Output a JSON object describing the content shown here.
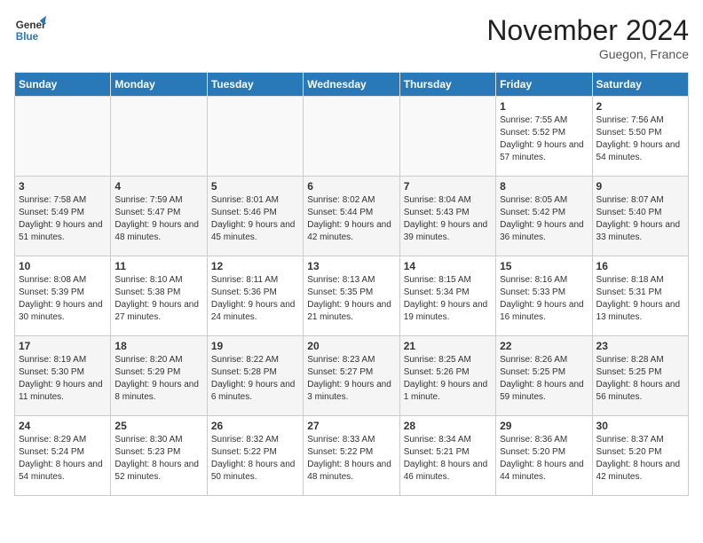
{
  "logo": {
    "line1": "General",
    "line2": "Blue"
  },
  "title": "November 2024",
  "location": "Guegon, France",
  "headers": [
    "Sunday",
    "Monday",
    "Tuesday",
    "Wednesday",
    "Thursday",
    "Friday",
    "Saturday"
  ],
  "weeks": [
    [
      {
        "day": "",
        "info": ""
      },
      {
        "day": "",
        "info": ""
      },
      {
        "day": "",
        "info": ""
      },
      {
        "day": "",
        "info": ""
      },
      {
        "day": "",
        "info": ""
      },
      {
        "day": "1",
        "info": "Sunrise: 7:55 AM\nSunset: 5:52 PM\nDaylight: 9 hours and 57 minutes."
      },
      {
        "day": "2",
        "info": "Sunrise: 7:56 AM\nSunset: 5:50 PM\nDaylight: 9 hours and 54 minutes."
      }
    ],
    [
      {
        "day": "3",
        "info": "Sunrise: 7:58 AM\nSunset: 5:49 PM\nDaylight: 9 hours and 51 minutes."
      },
      {
        "day": "4",
        "info": "Sunrise: 7:59 AM\nSunset: 5:47 PM\nDaylight: 9 hours and 48 minutes."
      },
      {
        "day": "5",
        "info": "Sunrise: 8:01 AM\nSunset: 5:46 PM\nDaylight: 9 hours and 45 minutes."
      },
      {
        "day": "6",
        "info": "Sunrise: 8:02 AM\nSunset: 5:44 PM\nDaylight: 9 hours and 42 minutes."
      },
      {
        "day": "7",
        "info": "Sunrise: 8:04 AM\nSunset: 5:43 PM\nDaylight: 9 hours and 39 minutes."
      },
      {
        "day": "8",
        "info": "Sunrise: 8:05 AM\nSunset: 5:42 PM\nDaylight: 9 hours and 36 minutes."
      },
      {
        "day": "9",
        "info": "Sunrise: 8:07 AM\nSunset: 5:40 PM\nDaylight: 9 hours and 33 minutes."
      }
    ],
    [
      {
        "day": "10",
        "info": "Sunrise: 8:08 AM\nSunset: 5:39 PM\nDaylight: 9 hours and 30 minutes."
      },
      {
        "day": "11",
        "info": "Sunrise: 8:10 AM\nSunset: 5:38 PM\nDaylight: 9 hours and 27 minutes."
      },
      {
        "day": "12",
        "info": "Sunrise: 8:11 AM\nSunset: 5:36 PM\nDaylight: 9 hours and 24 minutes."
      },
      {
        "day": "13",
        "info": "Sunrise: 8:13 AM\nSunset: 5:35 PM\nDaylight: 9 hours and 21 minutes."
      },
      {
        "day": "14",
        "info": "Sunrise: 8:15 AM\nSunset: 5:34 PM\nDaylight: 9 hours and 19 minutes."
      },
      {
        "day": "15",
        "info": "Sunrise: 8:16 AM\nSunset: 5:33 PM\nDaylight: 9 hours and 16 minutes."
      },
      {
        "day": "16",
        "info": "Sunrise: 8:18 AM\nSunset: 5:31 PM\nDaylight: 9 hours and 13 minutes."
      }
    ],
    [
      {
        "day": "17",
        "info": "Sunrise: 8:19 AM\nSunset: 5:30 PM\nDaylight: 9 hours and 11 minutes."
      },
      {
        "day": "18",
        "info": "Sunrise: 8:20 AM\nSunset: 5:29 PM\nDaylight: 9 hours and 8 minutes."
      },
      {
        "day": "19",
        "info": "Sunrise: 8:22 AM\nSunset: 5:28 PM\nDaylight: 9 hours and 6 minutes."
      },
      {
        "day": "20",
        "info": "Sunrise: 8:23 AM\nSunset: 5:27 PM\nDaylight: 9 hours and 3 minutes."
      },
      {
        "day": "21",
        "info": "Sunrise: 8:25 AM\nSunset: 5:26 PM\nDaylight: 9 hours and 1 minute."
      },
      {
        "day": "22",
        "info": "Sunrise: 8:26 AM\nSunset: 5:25 PM\nDaylight: 8 hours and 59 minutes."
      },
      {
        "day": "23",
        "info": "Sunrise: 8:28 AM\nSunset: 5:25 PM\nDaylight: 8 hours and 56 minutes."
      }
    ],
    [
      {
        "day": "24",
        "info": "Sunrise: 8:29 AM\nSunset: 5:24 PM\nDaylight: 8 hours and 54 minutes."
      },
      {
        "day": "25",
        "info": "Sunrise: 8:30 AM\nSunset: 5:23 PM\nDaylight: 8 hours and 52 minutes."
      },
      {
        "day": "26",
        "info": "Sunrise: 8:32 AM\nSunset: 5:22 PM\nDaylight: 8 hours and 50 minutes."
      },
      {
        "day": "27",
        "info": "Sunrise: 8:33 AM\nSunset: 5:22 PM\nDaylight: 8 hours and 48 minutes."
      },
      {
        "day": "28",
        "info": "Sunrise: 8:34 AM\nSunset: 5:21 PM\nDaylight: 8 hours and 46 minutes."
      },
      {
        "day": "29",
        "info": "Sunrise: 8:36 AM\nSunset: 5:20 PM\nDaylight: 8 hours and 44 minutes."
      },
      {
        "day": "30",
        "info": "Sunrise: 8:37 AM\nSunset: 5:20 PM\nDaylight: 8 hours and 42 minutes."
      }
    ]
  ]
}
